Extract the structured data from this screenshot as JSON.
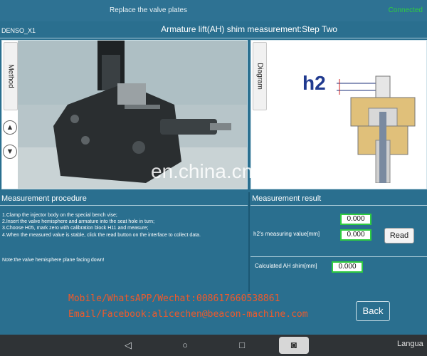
{
  "topbar": {
    "title": "Replace the valve plates",
    "status": "Connected"
  },
  "device": "DENSO_X1",
  "step_title": "Armature lift(AH) shim measurement:Step Two",
  "method_tab": "Method",
  "diagram_tab": "Diagram",
  "diagram_label": "h2",
  "watermark": "en.china.cn",
  "procedure": {
    "header": "Measurement procedure",
    "steps": [
      "1.Clamp the injector body on the special bench vise;",
      "2.Insert the valve hemisphere and armature into the seat hole in turn;",
      "3.Choose H05, mark zero with calibration block H11 and measure;",
      "4.When the measured value is stable, click the read button on the interface to collect data."
    ],
    "note": "Note:the valve hemisphere plane facing down!"
  },
  "result": {
    "header": "Measurement result",
    "h2_label": "h2's measuring value[mm]",
    "h2_value_top": "0.000",
    "h2_value": "0.000",
    "ah_label": "Calculated AH shim[mm]",
    "ah_value": "0.000",
    "read_button": "Read"
  },
  "back_button": "Back",
  "contact": {
    "line1": "Mobile/WhatsAPP/Wechat:008617660538861",
    "line2": "Email/Facebook:alicechen@beacon-machine.com"
  },
  "navbar": {
    "language": "Langua"
  },
  "icons": {
    "arrow_up": "arrow-up-icon",
    "arrow_down": "arrow-down-icon",
    "nav_back": "triangle-back-icon",
    "nav_home": "circle-home-icon",
    "nav_recent": "square-recent-icon",
    "camera": "camera-icon"
  },
  "colors": {
    "background": "#2a6f8f",
    "value_border": "#2ecc40",
    "contact_text": "#f05a2a",
    "diagram_label": "#203a8f"
  }
}
